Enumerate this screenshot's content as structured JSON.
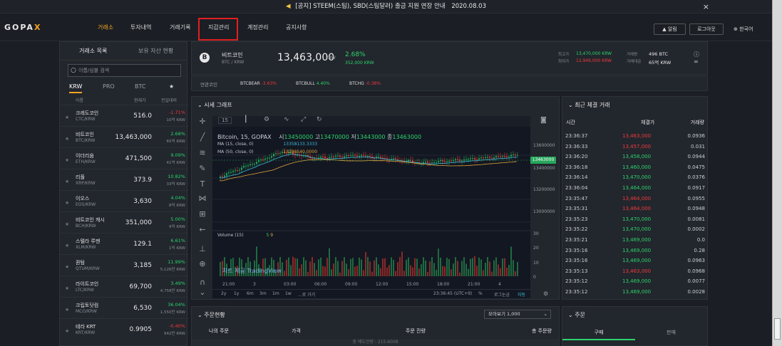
{
  "notice": {
    "text": "[공지] STEEM(스팀), SBD(스팀달러) 출금 지원 연장 안내",
    "date": "2020.08.03",
    "close": "×"
  },
  "brand": {
    "logo_main": "GOPA",
    "logo_x": "X"
  },
  "nav": {
    "items": [
      "거래소",
      "투자내역",
      "거래기록",
      "지갑관리",
      "계정관리",
      "공지사항"
    ],
    "login": "로그아웃",
    "alarm": "알림",
    "language": "한국어"
  },
  "left": {
    "tab_market": "거래소 목록",
    "tab_holdings": "보유 자산 현황",
    "search_placeholder": "이름/심볼 검색",
    "market_tabs": [
      "KRW",
      "PRO",
      "BTC",
      "★"
    ],
    "col_name": "이름",
    "col_price": "현재가",
    "col_change": "전일대비",
    "coins": [
      {
        "name": "크레도코인",
        "pair": "CTC/KRW",
        "price": "516.0",
        "change": "-1.71%",
        "vol": "10억 KRW",
        "dir": "dn"
      },
      {
        "name": "비트코인",
        "pair": "BTC/KRW",
        "price": "13,463,000",
        "change": "2.68%",
        "vol": "65억 KRW",
        "dir": "up"
      },
      {
        "name": "이더리움",
        "pair": "ETH/KRW",
        "price": "471,500",
        "change": "9.09%",
        "vol": "41억 KRW",
        "dir": "up"
      },
      {
        "name": "리플",
        "pair": "XRP/KRW",
        "price": "373.9",
        "change": "10.82%",
        "vol": "33억 KRW",
        "dir": "up"
      },
      {
        "name": "이오스",
        "pair": "EOS/KRW",
        "price": "3,630",
        "change": "4.04%",
        "vol": "8억 KRW",
        "dir": "up"
      },
      {
        "name": "비트코인 캐시",
        "pair": "BCH/KRW",
        "price": "351,000",
        "change": "5.00%",
        "vol": "9억 KRW",
        "dir": "up"
      },
      {
        "name": "스텔라 루멘",
        "pair": "XLM/KRW",
        "price": "129.1",
        "change": "6.61%",
        "vol": "1억 KRW",
        "dir": "up"
      },
      {
        "name": "퀀텀",
        "pair": "QTUM/KRW",
        "price": "3,185",
        "change": "11.99%",
        "vol": "5,126만 KRW",
        "dir": "up"
      },
      {
        "name": "라이트코인",
        "pair": "LTC/KRW",
        "price": "69,700",
        "change": "3.49%",
        "vol": "4,758만 KRW",
        "dir": "up"
      },
      {
        "name": "크립토닷컴",
        "pair": "MCO/KRW",
        "price": "6,530",
        "change": "36.04%",
        "vol": "1,550만 KRW",
        "dir": "up"
      },
      {
        "name": "테라 KRT",
        "pair": "KRT/KRW",
        "price": "0.9905",
        "change": "-0.40%",
        "vol": "942만 KRW",
        "dir": "dn"
      }
    ]
  },
  "ticker": {
    "name": "비트코인",
    "pair": "BTC / KRW",
    "price": "13,463,000",
    "unit": "KRW",
    "change": "2.68%",
    "change_amt": "352,000 KRW",
    "high_label": "최고가",
    "high": "13,470,000 KRW",
    "low_label": "최저가",
    "low": "12,949,000 KRW",
    "vol_label": "거래량",
    "vol": "496 BTC",
    "amt_label": "거래대금",
    "amt": "65억 KRW"
  },
  "related": {
    "label": "연관코인",
    "items": [
      {
        "name": "BTCBEAR",
        "chg": "-3.63%",
        "dir": "dn"
      },
      {
        "name": "BTCBULL",
        "chg": "4.40%",
        "dir": "up"
      },
      {
        "name": "BTCHG",
        "chg": "-0.38%",
        "dir": "dn"
      }
    ]
  },
  "chart": {
    "title": "시세 그래프",
    "interval": "15",
    "symbol_line": "Bitcoin, 15, GOPAX",
    "o_label": "시",
    "o": "13450000",
    "h_label": "고",
    "h": "13470000",
    "l_label": "저",
    "l": "13443000",
    "c_label": "종",
    "c": "13463000",
    "ma1": "MA (15, close, 0)",
    "ma1_val": "13358133.3333",
    "ma2": "MA (50, close, 0)",
    "ma2_val": "13298540.0000",
    "volume": "Volume (15)",
    "vol_a": "5",
    "vol_b": "9",
    "watermark": "차트 제공 TradingView",
    "price_tag": "13463000",
    "y_labels": [
      "13600000",
      "13400000",
      "13200000",
      "13000000"
    ],
    "vol_labels": [
      "30",
      "20",
      "10",
      "0"
    ],
    "x_labels": [
      "21:00",
      "3",
      "03:00",
      "06:00",
      "09:00",
      "12:00",
      "15:00",
      "18:00",
      "21:00",
      "4"
    ],
    "ranges": [
      "2y",
      "1y",
      "6m",
      "3m",
      "1m",
      "1w",
      "...로 가기"
    ],
    "time": "23:36:45 (UTC+9)",
    "pct": "%",
    "log": "로그눈금",
    "auto": "자동"
  },
  "trades": {
    "title": "최근 체결 거래",
    "col_time": "시간",
    "col_price": "체결가",
    "col_amt": "거래량",
    "rows": [
      {
        "t": "23:36:37",
        "p": "13,463,000",
        "a": "0.0936",
        "dir": "dn"
      },
      {
        "t": "23:36:33",
        "p": "13,457,000",
        "a": "0.031",
        "dir": "dn"
      },
      {
        "t": "23:36:20",
        "p": "13,458,000",
        "a": "0.0944",
        "dir": "up"
      },
      {
        "t": "23:36:18",
        "p": "13,460,000",
        "a": "0.0475",
        "dir": "up"
      },
      {
        "t": "23:36:14",
        "p": "13,470,000",
        "a": "0.0376",
        "dir": "up"
      },
      {
        "t": "23:36:04",
        "p": "13,464,000",
        "a": "0.0917",
        "dir": "up"
      },
      {
        "t": "23:35:47",
        "p": "13,464,000",
        "a": "0.0955",
        "dir": "dn"
      },
      {
        "t": "23:35:31",
        "p": "13,464,000",
        "a": "0.0948",
        "dir": "dn"
      },
      {
        "t": "23:35:23",
        "p": "13,470,000",
        "a": "0.0081",
        "dir": "up"
      },
      {
        "t": "23:35:22",
        "p": "13,470,000",
        "a": "0.0002",
        "dir": "up"
      },
      {
        "t": "23:35:21",
        "p": "13,469,000",
        "a": "0.0",
        "dir": "up"
      },
      {
        "t": "23:35:16",
        "p": "13,469,000",
        "a": "0.28",
        "dir": "up"
      },
      {
        "t": "23:35:16",
        "p": "13,469,000",
        "a": "0.0963",
        "dir": "up"
      },
      {
        "t": "23:35:13",
        "p": "13,463,000",
        "a": "0.0968",
        "dir": "dn"
      },
      {
        "t": "23:35:12",
        "p": "13,469,000",
        "a": "0.0077",
        "dir": "up"
      },
      {
        "t": "23:35:12",
        "p": "13,469,000",
        "a": "0.0028",
        "dir": "up"
      }
    ]
  },
  "orders": {
    "title": "주문현황",
    "view": "모아보기 1,000",
    "col_mine": "나의 주문",
    "col_price": "가격",
    "col_amount": "주문 잔량",
    "col_total": "총 주문량",
    "bottom_hint": "총 매도잔량 : 215.6008"
  },
  "order_form": {
    "title": "주문",
    "buy": "구매",
    "sell": "판매"
  }
}
